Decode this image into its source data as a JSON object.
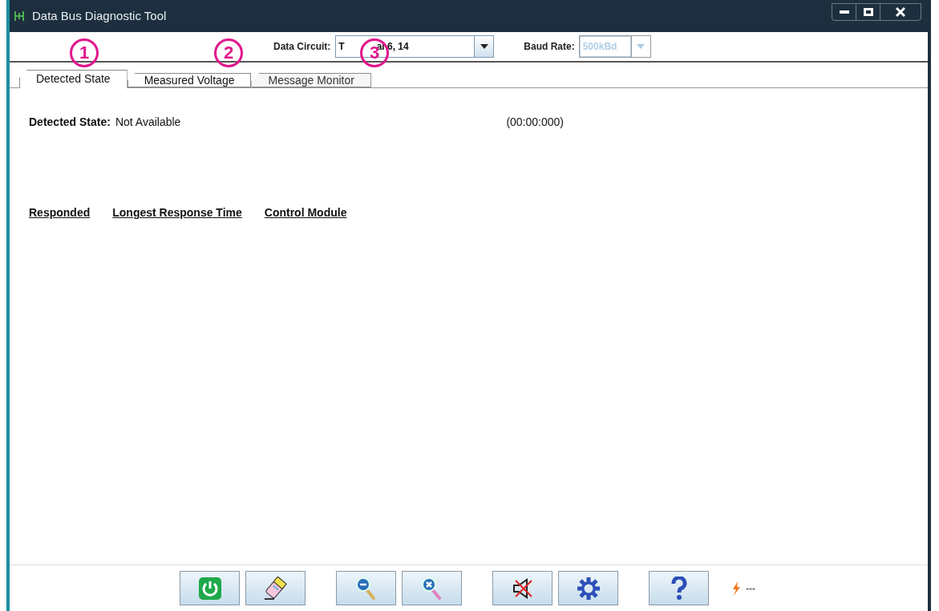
{
  "window": {
    "title": "Data Bus Diagnostic Tool"
  },
  "callouts": [
    "1",
    "2",
    "3"
  ],
  "data_circuit": {
    "label": "Data Circuit:",
    "value_start": "T",
    "value_end": "al 6, 14"
  },
  "baud_rate": {
    "label": "Baud Rate:",
    "value": "500kBd",
    "disabled": true
  },
  "tabs": [
    {
      "label": "Detected State",
      "selected": true,
      "disabled": false
    },
    {
      "label": "Measured Voltage",
      "selected": false,
      "disabled": false
    },
    {
      "label": "Message Monitor",
      "selected": false,
      "disabled": true
    }
  ],
  "detected_state": {
    "label": "Detected State:",
    "value": "Not Available",
    "time": "(00:00:000)"
  },
  "columns": [
    "Responded",
    "Longest Response Time",
    "Control Module"
  ],
  "toolbar": [
    {
      "kind": "power"
    },
    {
      "kind": "eraser"
    },
    {
      "kind": "zoom_out"
    },
    {
      "kind": "zoom_reset"
    },
    {
      "kind": "mute"
    },
    {
      "kind": "settings"
    },
    {
      "kind": "help"
    }
  ],
  "status": {
    "text": "---"
  }
}
